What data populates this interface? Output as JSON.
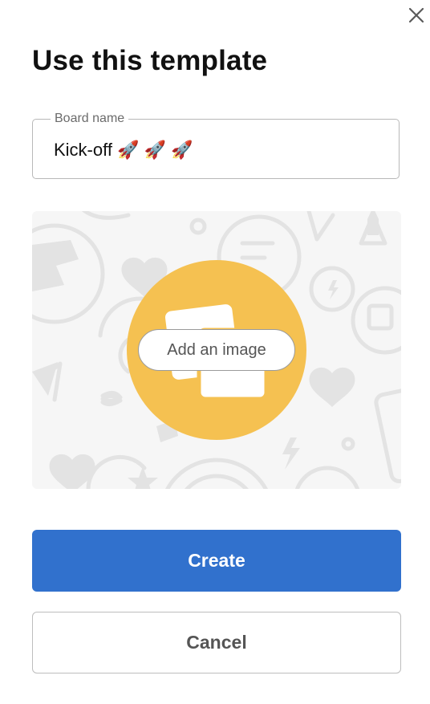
{
  "dialog": {
    "title": "Use this template",
    "close_icon": "close-icon"
  },
  "board_name": {
    "label": "Board name",
    "value": "Kick-off 🚀 🚀 🚀"
  },
  "image_picker": {
    "button_label": "Add an image",
    "accent_color": "#f5c151",
    "icon": "image-stack-icon"
  },
  "actions": {
    "create_label": "Create",
    "cancel_label": "Cancel",
    "create_color": "#3171cd"
  }
}
